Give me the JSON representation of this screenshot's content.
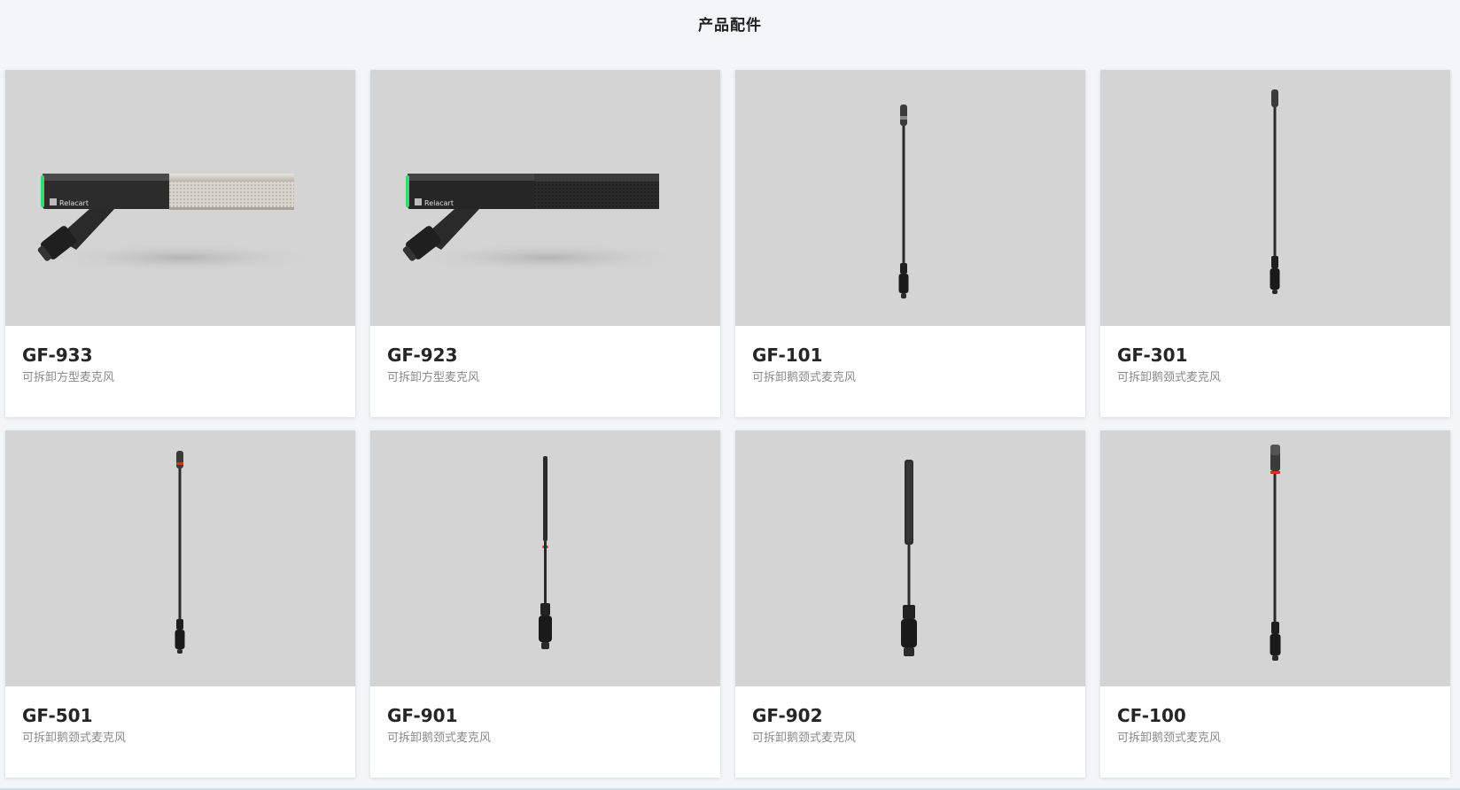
{
  "page": {
    "title": "产品配件"
  },
  "products": [
    {
      "model": "GF-933",
      "desc": "可拆卸方型麦克风",
      "style": "box-silver",
      "brand": "Relacart"
    },
    {
      "model": "GF-923",
      "desc": "可拆卸方型麦克风",
      "style": "box-black",
      "brand": "Relacart"
    },
    {
      "model": "GF-101",
      "desc": "可拆卸鹅颈式麦克风",
      "style": "gooseneck-short"
    },
    {
      "model": "GF-301",
      "desc": "可拆卸鹅颈式麦克风",
      "style": "gooseneck-long"
    },
    {
      "model": "GF-501",
      "desc": "可拆卸鹅颈式麦克风",
      "style": "gooseneck-redring"
    },
    {
      "model": "GF-901",
      "desc": "可拆卸鹅颈式麦克风",
      "style": "gooseneck-thin"
    },
    {
      "model": "GF-902",
      "desc": "可拆卸鹅颈式麦克风",
      "style": "gooseneck-thick"
    },
    {
      "model": "CF-100",
      "desc": "可拆卸鹅颈式麦克风",
      "style": "gooseneck-redring-long"
    }
  ]
}
